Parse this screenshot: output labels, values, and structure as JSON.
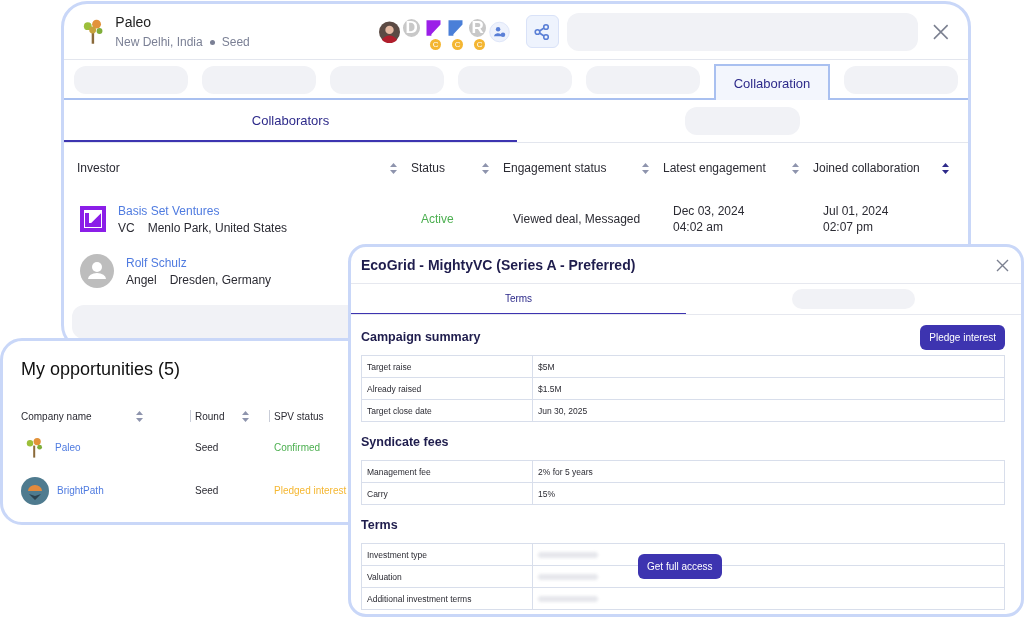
{
  "collab_panel": {
    "company": {
      "name": "Paleo",
      "location": "New Delhi, India",
      "stage": "Seed"
    },
    "avatars": [
      {
        "kind": "photo"
      },
      {
        "kind": "letter",
        "letter": "D"
      },
      {
        "kind": "logo",
        "color": "#9b1fe8",
        "badge": "C"
      },
      {
        "kind": "logo",
        "color": "#4a7fd8",
        "badge": "C"
      },
      {
        "kind": "letter",
        "letter": "R",
        "badge": "C"
      },
      {
        "kind": "add"
      }
    ],
    "tabs": [
      {
        "kind": "placeholder",
        "selected": false
      },
      {
        "kind": "placeholder",
        "selected": false
      },
      {
        "kind": "placeholder",
        "selected": false
      },
      {
        "kind": "placeholder",
        "selected": false
      },
      {
        "kind": "placeholder",
        "selected": false
      },
      {
        "kind": "tab",
        "label": "Collaboration",
        "selected": true
      },
      {
        "kind": "placeholder",
        "selected": false
      }
    ],
    "subtabs": [
      {
        "kind": "tab",
        "label": "Collaborators",
        "selected": true
      },
      {
        "kind": "placeholder",
        "selected": false
      }
    ],
    "table": {
      "columns": [
        {
          "label": "Investor",
          "sorted": false
        },
        {
          "label": "Status",
          "sorted": false
        },
        {
          "label": "Engagement status",
          "sorted": false
        },
        {
          "label": "Latest engagement",
          "sorted": false
        },
        {
          "label": "Joined collaboration",
          "sorted": true
        }
      ],
      "rows": [
        {
          "kind": "company",
          "name": "Basis Set Ventures",
          "type": "VC",
          "location": "Menlo Park, United States",
          "status": "Active",
          "engagement": "Viewed deal, Messaged",
          "latest_date": "Dec 03, 2024",
          "latest_time": "04:02 am",
          "joined_date": "Jul 01, 2024",
          "joined_time": "02:07 pm"
        },
        {
          "kind": "person",
          "name": "Rolf Schulz",
          "type": "Angel",
          "location": "Dresden, Germany"
        },
        {
          "kind": "placeholder"
        }
      ]
    }
  },
  "opportunities": {
    "title": "My opportunities (5)",
    "columns": [
      {
        "label": "Company name",
        "sortable": true
      },
      {
        "label": "Round",
        "sortable": true
      },
      {
        "label": "SPV status",
        "sortable": false
      }
    ],
    "rows": [
      {
        "kind": "tree",
        "name": "Paleo",
        "round": "Seed",
        "spv_status": "Confirmed",
        "color": "#4caf50"
      },
      {
        "kind": "round",
        "name": "BrightPath",
        "round": "Seed",
        "spv_status": "Pledged interest",
        "color": "#f5b731"
      }
    ]
  },
  "deal_dialog": {
    "title": "EcoGrid - MightyVC (Series A - Preferred)",
    "tabs": [
      {
        "kind": "tab",
        "label": "Terms",
        "selected": true
      },
      {
        "kind": "placeholder",
        "selected": false
      }
    ],
    "sections": [
      {
        "title": "Campaign summary",
        "action": "Pledge interest",
        "rows": [
          {
            "label": "Target raise",
            "value": "$5M"
          },
          {
            "label": "Already raised",
            "value": "$1.5M"
          },
          {
            "label": "Target close date",
            "value": "Jun 30, 2025"
          }
        ]
      },
      {
        "title": "Syndicate fees",
        "rows": [
          {
            "label": "Management fee",
            "value": "2% for 5 years"
          },
          {
            "label": "Carry",
            "value": "15%"
          }
        ]
      },
      {
        "title": "Terms",
        "locked": true,
        "rows": [
          {
            "label": "Investment type"
          },
          {
            "label": "Valuation"
          },
          {
            "label": "Additional investment terms"
          }
        ]
      }
    ],
    "unlock_button": "Get full access"
  }
}
